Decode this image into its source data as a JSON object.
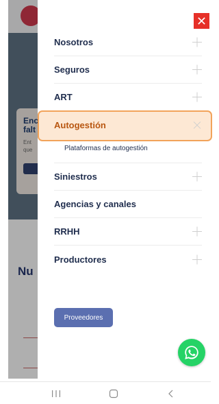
{
  "background": {
    "card_title_lines": [
      "Enc",
      "falt"
    ],
    "card_text_lines": [
      "Ent",
      "que"
    ],
    "card_button": "C",
    "section_title": "Nu"
  },
  "menu": {
    "items": [
      {
        "label": "Nosotros",
        "icon": "plus-icon"
      },
      {
        "label": "Seguros",
        "icon": "plus-icon"
      },
      {
        "label": "ART",
        "icon": "plus-icon"
      },
      {
        "label": "Autogestión",
        "icon": "close-icon",
        "expanded": true,
        "subitems": [
          "Plataformas de autogestión"
        ]
      },
      {
        "label": "Siniestros",
        "icon": "plus-icon"
      },
      {
        "label": "Agencias y canales"
      },
      {
        "label": "RRHH",
        "icon": "plus-icon"
      },
      {
        "label": "Productores",
        "icon": "plus-icon"
      }
    ]
  },
  "buttons": {
    "proveedores": "Proveedores"
  },
  "colors": {
    "close_button": "#e63028",
    "active_highlight": "#fde8d4",
    "active_border": "#f2a35a",
    "menu_text": "#1f2d4d",
    "proveedores_button": "#5b6fb0",
    "whatsapp": "#25d366"
  },
  "icons": {
    "close": "close-icon",
    "whatsapp": "whatsapp-icon",
    "nav_recents": "recents-icon",
    "nav_home": "home-icon",
    "nav_back": "back-icon"
  }
}
